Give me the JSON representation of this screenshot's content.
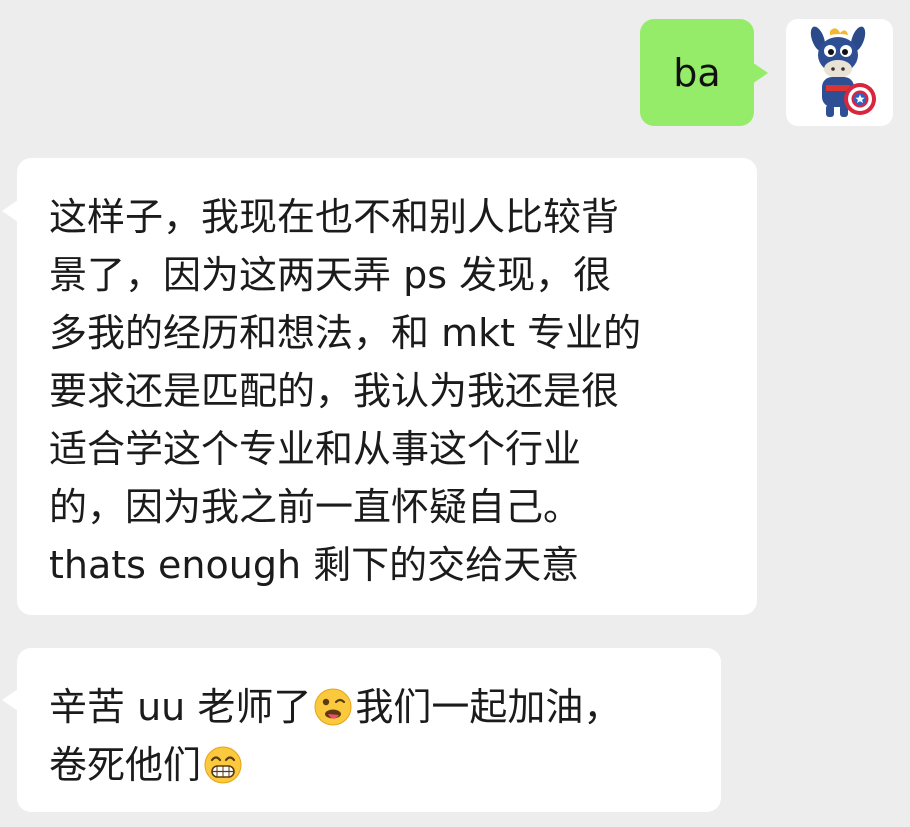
{
  "messages": [
    {
      "sender": "me",
      "text": "ba"
    },
    {
      "sender": "other",
      "lines": [
        "这样子，我现在也不和别人比较背",
        "景了，因为这两天弄 ps 发现，很",
        "多我的经历和想法，和 mkt 专业的",
        "要求还是匹配的，我认为我还是很",
        "适合学这个专业和从事这个行业",
        "的，因为我之前一直怀疑自己。",
        "thats enough 剩下的交给天意"
      ]
    },
    {
      "sender": "other",
      "line1_before": "辛苦 uu 老师了",
      "line1_after": "我们一起加油，",
      "line2": "卷死他们",
      "emojis": [
        "winking-tongue-emoji",
        "grinning-face-emoji"
      ]
    }
  ],
  "avatar": {
    "icon": "cartoon-donkey-captain-shield-icon"
  },
  "colors": {
    "background": "#ededed",
    "sent_bubble": "#95ec69",
    "received_bubble": "#ffffff",
    "text": "#1b1b1b"
  }
}
